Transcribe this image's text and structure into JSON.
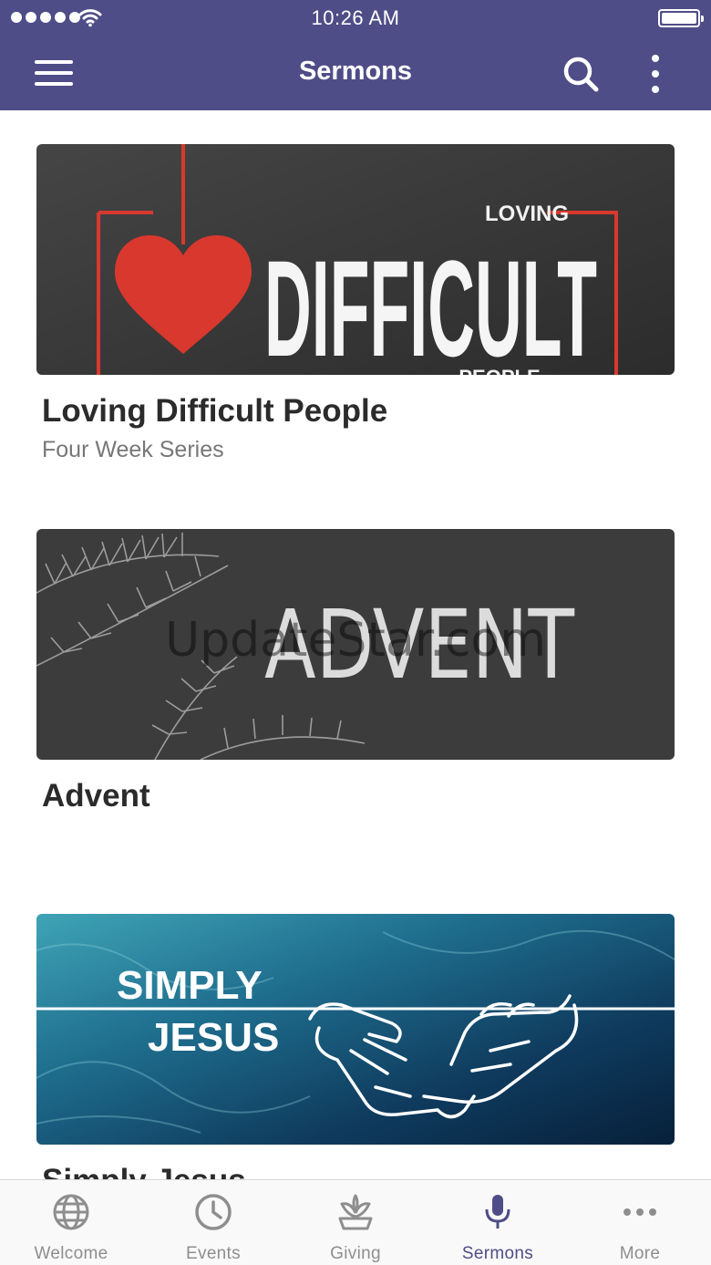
{
  "status_bar": {
    "time": "10:26 AM",
    "signal_icon": "signal-bars-icon",
    "wifi_icon": "wifi-icon",
    "battery_icon": "battery-icon",
    "battery_level": 1.0
  },
  "nav": {
    "title": "Sermons",
    "menu_icon": "hamburger-menu-icon",
    "search_icon": "search-icon",
    "more_icon": "vertical-ellipsis-icon"
  },
  "colors": {
    "brand": "#4f4d87",
    "tab_inactive": "#8e8e8e",
    "heart_red": "#d9382e"
  },
  "sermons": [
    {
      "title": "Loving Difficult People",
      "subtitle": "Four Week Series",
      "artwork": {
        "small_word_top": "LOVING",
        "big_word": "DIFFICULT",
        "small_word_bottom": "PEOPLE"
      }
    },
    {
      "title": "Advent",
      "subtitle": "",
      "artwork": {
        "big_word": "ADVENT"
      }
    },
    {
      "title": "Simply Jesus",
      "subtitle": "",
      "artwork": {
        "line1": "SIMPLY",
        "line2": "JESUS"
      }
    }
  ],
  "watermark": "UpdateStar.com",
  "tabs": [
    {
      "label": "Welcome",
      "icon": "globe-icon",
      "active": false
    },
    {
      "label": "Events",
      "icon": "clock-icon",
      "active": false
    },
    {
      "label": "Giving",
      "icon": "giving-plant-icon",
      "active": false
    },
    {
      "label": "Sermons",
      "icon": "microphone-icon",
      "active": true
    },
    {
      "label": "More",
      "icon": "horizontal-ellipsis-icon",
      "active": false
    }
  ]
}
